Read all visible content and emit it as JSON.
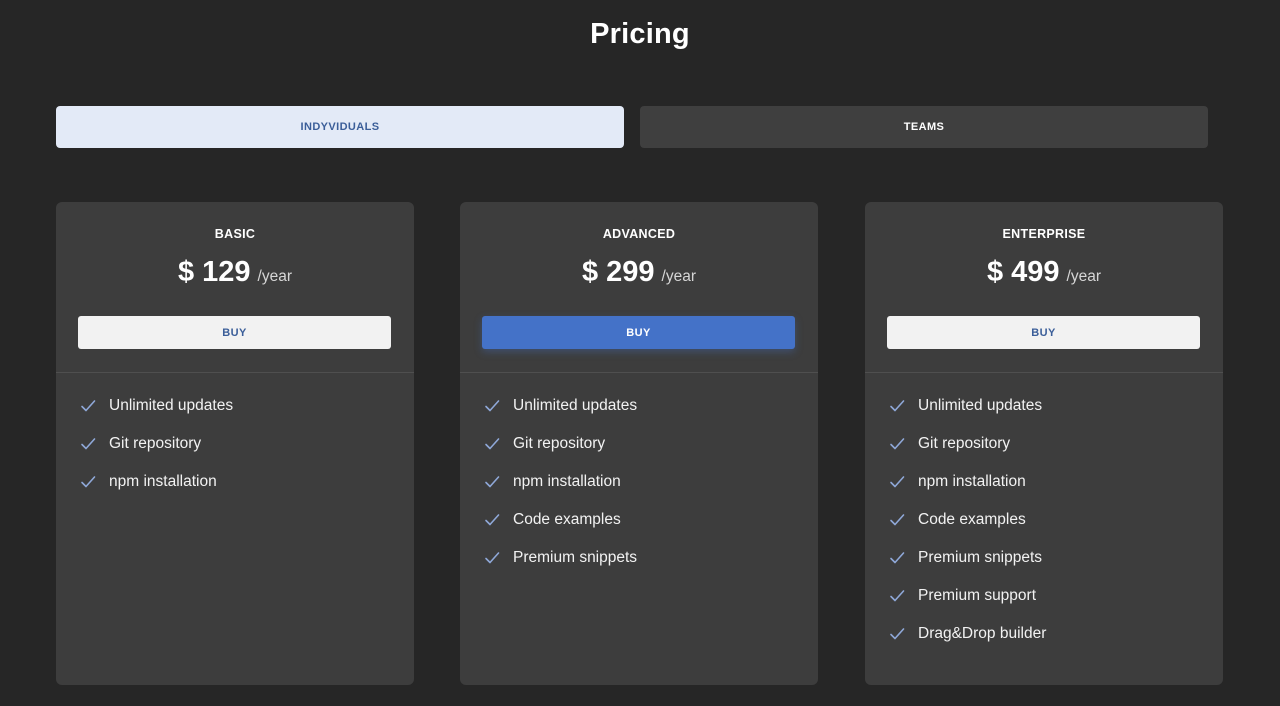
{
  "page": {
    "title": "Pricing"
  },
  "tabs": [
    {
      "label": "INDYVIDUALS",
      "active": true
    },
    {
      "label": "TEAMS",
      "active": false
    }
  ],
  "colors": {
    "background": "#262626",
    "card": "#3d3d3d",
    "accent": "#4472c8",
    "active_tab": "#e3eaf7",
    "check": "#8fa8d8"
  },
  "plans": [
    {
      "name": "BASIC",
      "price": "$ 129",
      "period": "/year",
      "buy_label": "BUY",
      "features": [
        "Unlimited updates",
        "Git repository",
        "npm installation"
      ]
    },
    {
      "name": "ADVANCED",
      "price": "$ 299",
      "period": "/year",
      "buy_label": "BUY",
      "features": [
        "Unlimited updates",
        "Git repository",
        "npm installation",
        "Code examples",
        "Premium snippets"
      ]
    },
    {
      "name": "ENTERPRISE",
      "price": "$ 499",
      "period": "/year",
      "buy_label": "BUY",
      "features": [
        "Unlimited updates",
        "Git repository",
        "npm installation",
        "Code examples",
        "Premium snippets",
        "Premium support",
        "Drag&Drop builder"
      ]
    }
  ],
  "icons": {
    "feature_bullet": "check-icon"
  }
}
